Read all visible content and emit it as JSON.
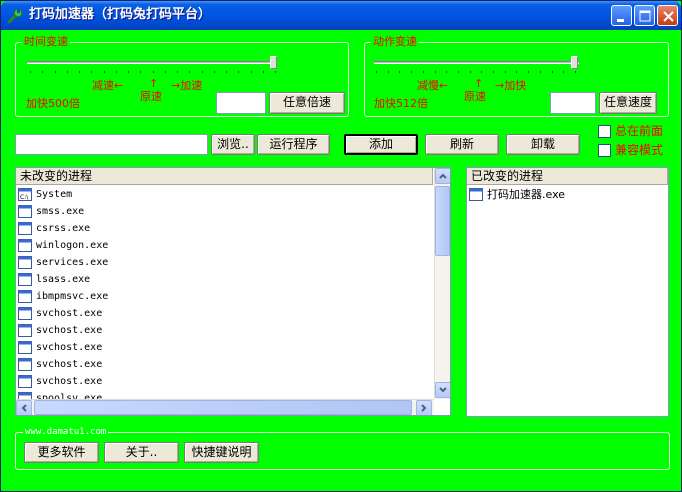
{
  "window": {
    "title": "打码加速器（打码兔打码平台）"
  },
  "time_group": {
    "legend": "时间变速",
    "slow_label": "减速←",
    "up_arrow": "↑",
    "normal_label": "原速",
    "fast_label": "→加速",
    "status": "加快500倍",
    "multiplier_value": "",
    "apply_button": "任意倍速"
  },
  "action_group": {
    "legend": "动作变速",
    "slow_label": "减慢←",
    "up_arrow": "↑",
    "normal_label": "原速",
    "fast_label": "→加快",
    "status": "加快512倍",
    "speed_value": "",
    "apply_button": "任意速度"
  },
  "toolbar": {
    "path_value": "",
    "browse_button": "浏览..",
    "run_button": "运行程序",
    "add_button": "添加",
    "refresh_button": "刷新",
    "unload_button": "卸载",
    "always_on_top_label": "总在前面",
    "compat_mode_label": "兼容模式",
    "always_on_top_checked": false,
    "compat_mode_checked": false
  },
  "unchanged_list": {
    "header": "未改变的进程",
    "rows": [
      {
        "name": "System",
        "icon": "system-process-icon"
      },
      {
        "name": "smss.exe",
        "icon": "window-app-icon"
      },
      {
        "name": "csrss.exe",
        "icon": "window-app-icon"
      },
      {
        "name": "winlogon.exe",
        "icon": "window-app-icon"
      },
      {
        "name": "services.exe",
        "icon": "window-app-icon"
      },
      {
        "name": "lsass.exe",
        "icon": "window-app-icon"
      },
      {
        "name": "ibmpmsvc.exe",
        "icon": "window-app-icon"
      },
      {
        "name": "svchost.exe",
        "icon": "window-app-icon"
      },
      {
        "name": "svchost.exe",
        "icon": "window-app-icon"
      },
      {
        "name": "svchost.exe",
        "icon": "window-app-icon"
      },
      {
        "name": "svchost.exe",
        "icon": "window-app-icon"
      },
      {
        "name": "svchost.exe",
        "icon": "window-app-icon"
      },
      {
        "name": "spoolsv.exe",
        "icon": "window-app-icon"
      }
    ]
  },
  "changed_list": {
    "header": "已改变的进程",
    "rows": [
      {
        "name": "打码加速器.exe",
        "icon": "window-app-icon"
      }
    ]
  },
  "footer": {
    "site": "www.damatu1.com",
    "more_button": "更多软件",
    "about_button": "关于..",
    "hotkey_button": "快捷键说明"
  },
  "colors": {
    "background": "#00ff00",
    "label_red": "#ff0000",
    "titlebar_blue": "#0054e3"
  }
}
